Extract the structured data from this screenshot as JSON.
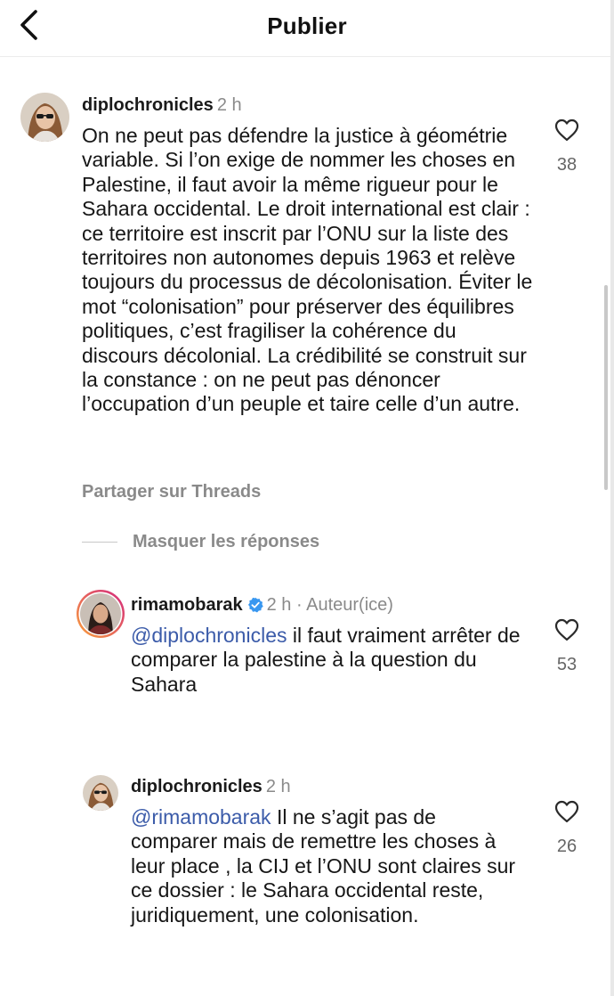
{
  "header": {
    "title": "Publier",
    "back_icon": "chevron-left-icon"
  },
  "comments": [
    {
      "username": "diplochronicles",
      "time": "2 h",
      "text": "On ne peut pas défendre la justice à géométrie variable. Si l’on exige de nommer les choses en Palestine, il faut avoir la même rigueur pour le Sahara occidental. Le droit international est clair : ce territoire est inscrit par l’ONU sur la liste des territoires non autonomes depuis 1963 et relève toujours du processus de décolonisation. Éviter le mot “colonisation” pour préserver des équilibres politiques, c’est fragiliser la cohérence du discours décolonial. La crédibilité se construit sur la constance : on ne peut pas dénoncer l’occupation d’un peuple et taire celle d’un autre.",
      "likes": "38",
      "share_label": "Partager sur Threads",
      "hide_replies_label": "Masquer les réponses"
    }
  ],
  "replies": [
    {
      "username": "rimamobarak",
      "time": "2 h",
      "author_tag": "· Auteur(ice)",
      "verified": true,
      "mention": "@diplochronicles",
      "text": " il faut vraiment arrêter de comparer la palestine à la question du Sahara",
      "likes": "53"
    },
    {
      "username": "diplochronicles",
      "time": "2 h",
      "mention": "@rimamobarak",
      "text": " Il ne s’agit pas de comparer mais de remettre les choses à leur place , la CIJ et l’ONU sont claires sur ce dossier : le Sahara occidental reste, juridiquement, une colonisation.",
      "likes": "26"
    }
  ],
  "colors": {
    "mention": "#3b5ba9",
    "muted": "#8a8a8a",
    "verified": "#3897f0",
    "story_ring_start": "#f9a13a",
    "story_ring_end": "#d3277f"
  },
  "icons": {
    "like": "heart-outline-icon",
    "verified": "verified-badge-icon"
  }
}
